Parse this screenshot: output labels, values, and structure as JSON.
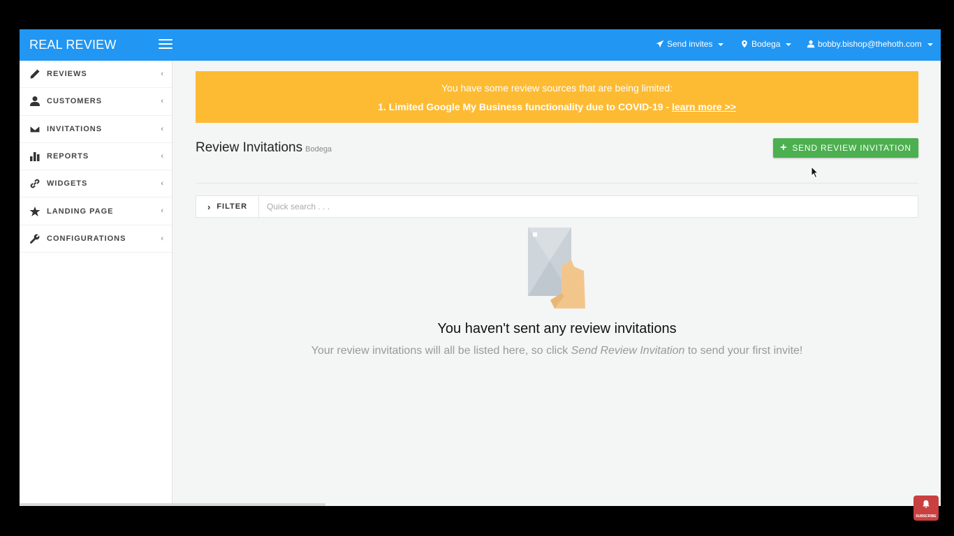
{
  "topbar": {
    "brand": "REAL REVIEW",
    "nav": {
      "send_invites": "Send invites",
      "location": "Bodega",
      "user_email": "bobby.bishop@thehoth.com"
    }
  },
  "sidebar": {
    "items": [
      {
        "label": "REVIEWS",
        "icon": "pencil-icon"
      },
      {
        "label": "CUSTOMERS",
        "icon": "user-icon"
      },
      {
        "label": "INVITATIONS",
        "icon": "envelope-icon"
      },
      {
        "label": "REPORTS",
        "icon": "bar-chart-icon"
      },
      {
        "label": "WIDGETS",
        "icon": "link-icon"
      },
      {
        "label": "LANDING PAGE",
        "icon": "star-icon"
      },
      {
        "label": "CONFIGURATIONS",
        "icon": "wrench-icon"
      }
    ]
  },
  "alert": {
    "line1": "You have some review sources that are being limited:",
    "line2": "1. Limited Google My Business functionality due to COVID-19 - ",
    "link": "learn more >>",
    "color": "#fdbb33"
  },
  "header": {
    "title": "Review Invitations",
    "subtitle": "Bodega",
    "send_button": "SEND REVIEW INVITATION"
  },
  "filter": {
    "label": "FILTER",
    "search_placeholder": "Quick search . . ."
  },
  "empty_state": {
    "title": "You haven't sent any review invitations",
    "desc_before": "Your review invitations will all be listed here, so click ",
    "desc_emph": "Send Review Invitation",
    "desc_after": " to send your first invite!"
  },
  "overlay": {
    "subscribe": "SUBSCRIBE"
  },
  "colors": {
    "topbar": "#2196f3",
    "send_button": "#4caf50",
    "alert": "#fdbb33"
  }
}
